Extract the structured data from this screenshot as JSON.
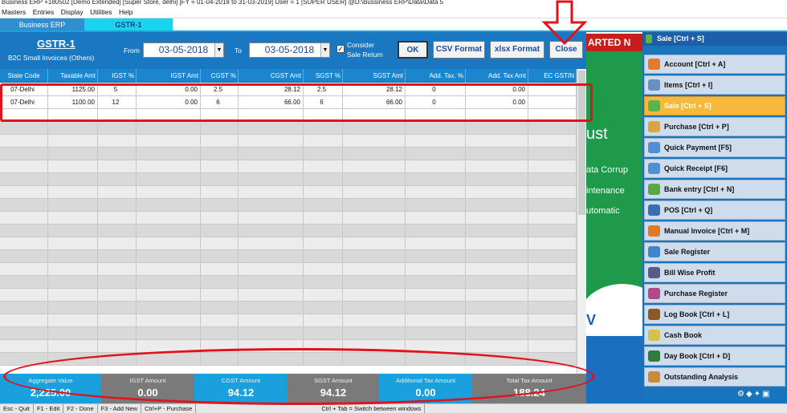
{
  "window_title": "Business ERP +180502 [Demo Extended] [Super Store, delhi] [FY = 01-04-2018 to 31-03-2019] User = 1 [SUPER USER] @D:\\Bussiness ERP\\Data\\Data 5",
  "menu": [
    "Masters",
    "Entries",
    "Display",
    "Utilities",
    "Help"
  ],
  "tabs": {
    "app": "Business ERP",
    "gstr": "GSTR-1"
  },
  "header": {
    "title": "GSTR-1",
    "subtitle": "B2C Small Invoices (Others)",
    "from_label": "From",
    "from_date": "03-05-2018",
    "to_label": "To",
    "to_date": "03-05-2018",
    "consider_label_1": "Consider",
    "consider_label_2": "Sale Return",
    "consider_checked": true,
    "ok_label": "OK",
    "csv_label": "CSV Format",
    "xlsx_label": "xlsx Format",
    "close_label": "Close"
  },
  "table": {
    "columns": [
      "State Code",
      "Taxable Amt",
      "IGST %",
      "IGST Amt",
      "CGST %",
      "CGST Amt",
      "SGST %",
      "SGST Amt",
      "Add. Tax. %",
      "Add. Tax Amt",
      "EC GSTIN"
    ],
    "rows": [
      [
        "07-Delhi",
        "1125.00",
        "5",
        "0.00",
        "2.5",
        "28.12",
        "2.5",
        "28.12",
        "0",
        "0.00",
        ""
      ],
      [
        "07-Delhi",
        "1100.00",
        "12",
        "0.00",
        "6",
        "66.00",
        "6",
        "66.00",
        "0",
        "0.00",
        ""
      ]
    ]
  },
  "footer": [
    {
      "label": "Aggregate Value",
      "value": "2,225.00",
      "color": "#1aa0dc"
    },
    {
      "label": "IGST Amount",
      "value": "0.00",
      "color": "#7a7a7a"
    },
    {
      "label": "CGST Amount",
      "value": "94.12",
      "color": "#1aa0dc"
    },
    {
      "label": "SGST Amount",
      "value": "94.12",
      "color": "#7a7a7a"
    },
    {
      "label": "Additional Tax Amount",
      "value": "0.00",
      "color": "#1aa0dc"
    },
    {
      "label": "Total Tax Amount",
      "value": "188.24",
      "color": "#7a7a7a"
    }
  ],
  "background_fragments": {
    "banner": "ARTED N",
    "t1": "ust",
    "t2": "ata Corrup",
    "t3": "intenance",
    "t4": "utomatic",
    "t5": "V"
  },
  "sidebar": {
    "header": "Sale [Ctrl + S]",
    "items": [
      {
        "label": "Account [Ctrl + A]",
        "icon": "account-icon",
        "color": "#e8782a"
      },
      {
        "label": "Items [Ctrl + I]",
        "icon": "items-icon",
        "color": "#6a8fc4"
      },
      {
        "label": "Sale [Ctrl + S]",
        "icon": "sale-icon",
        "color": "#5cb54a",
        "active": true
      },
      {
        "label": "Purchase [Ctrl + P]",
        "icon": "purchase-icon",
        "color": "#d9a441"
      },
      {
        "label": "Quick Payment [F5]",
        "icon": "quick-payment-icon",
        "color": "#4f8fd6"
      },
      {
        "label": "Quick Receipt [F6]",
        "icon": "quick-receipt-icon",
        "color": "#4f8fd6"
      },
      {
        "label": "Bank entry [Ctrl + N]",
        "icon": "bank-entry-icon",
        "color": "#5aa845"
      },
      {
        "label": "POS [Ctrl + Q]",
        "icon": "pos-icon",
        "color": "#3a6fb8"
      },
      {
        "label": "Manual Invoice [Ctrl + M]",
        "icon": "manual-invoice-icon",
        "color": "#e07a22"
      },
      {
        "label": "Sale Register",
        "icon": "sale-register-icon",
        "color": "#3f86cf"
      },
      {
        "label": "Bill Wise Profit",
        "icon": "bill-wise-profit-icon",
        "color": "#5a5a8a"
      },
      {
        "label": "Purchase Register",
        "icon": "purchase-register-icon",
        "color": "#b04a8a"
      },
      {
        "label": "Log Book [Ctrl + L]",
        "icon": "log-book-icon",
        "color": "#8a5a2a"
      },
      {
        "label": "Cash Book",
        "icon": "cash-book-icon",
        "color": "#d6c24a"
      },
      {
        "label": "Day Book [Ctrl + D]",
        "icon": "day-book-icon",
        "color": "#2f7a3f"
      },
      {
        "label": "Outstanding Analysis",
        "icon": "outstanding-analysis-icon",
        "color": "#c98a3a"
      }
    ]
  },
  "status_bar": [
    "Esc - Quit",
    "F1 - Edit",
    "F2 - Done",
    "F3 - Add New",
    "Ctrl+P - Purchase",
    "",
    "",
    "",
    "",
    "Ctrl + Tab = Switch between windows"
  ]
}
